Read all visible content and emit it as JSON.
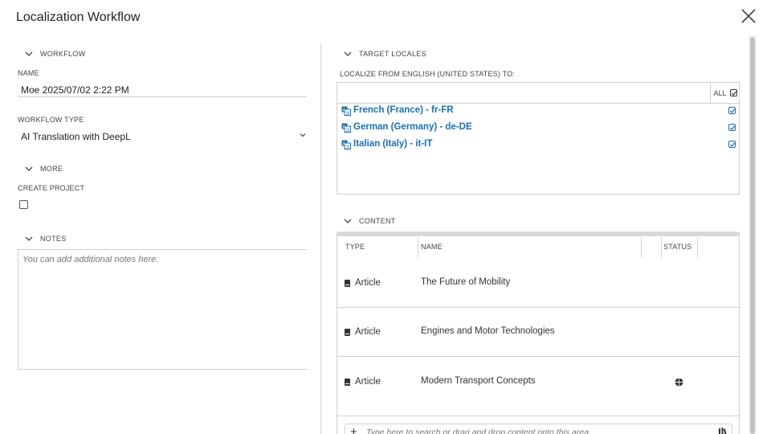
{
  "dialog": {
    "title": "Localization Workflow"
  },
  "workflow": {
    "section_label": "WORKFLOW",
    "name_label": "NAME",
    "name_value": "Moe 2025/07/02 2:22 PM",
    "type_label": "WORKFLOW TYPE",
    "type_value": "AI Translation with DeepL"
  },
  "more": {
    "section_label": "MORE",
    "create_project_label": "CREATE PROJECT",
    "create_project_checked": false
  },
  "notes": {
    "section_label": "NOTES",
    "placeholder": "You can add additional notes here."
  },
  "target_locales": {
    "section_label": "TARGET LOCALES",
    "localize_from_label": "LOCALIZE FROM ENGLISH (UNITED STATES) TO:",
    "all_label": "ALL",
    "locales": [
      {
        "label": "French (France) - fr-FR",
        "checked": true
      },
      {
        "label": "German (Germany) - de-DE",
        "checked": true
      },
      {
        "label": "Italian (Italy) - it-IT",
        "checked": true
      }
    ]
  },
  "content": {
    "section_label": "CONTENT",
    "columns": {
      "type": "TYPE",
      "name": "NAME",
      "status": "STATUS"
    },
    "rows": [
      {
        "type": "Article",
        "name": "The Future of Mobility",
        "status_icon": ""
      },
      {
        "type": "Article",
        "name": "Engines and Motor Technologies",
        "status_icon": ""
      },
      {
        "type": "Article",
        "name": "Modern Transport Concepts",
        "status_icon": "globe-icon"
      }
    ],
    "search_placeholder": "Type here to search or drag and drop content onto this area"
  },
  "colors": {
    "accent": "#1a6fb5",
    "text": "#333333",
    "border": "#cfcfcf"
  }
}
